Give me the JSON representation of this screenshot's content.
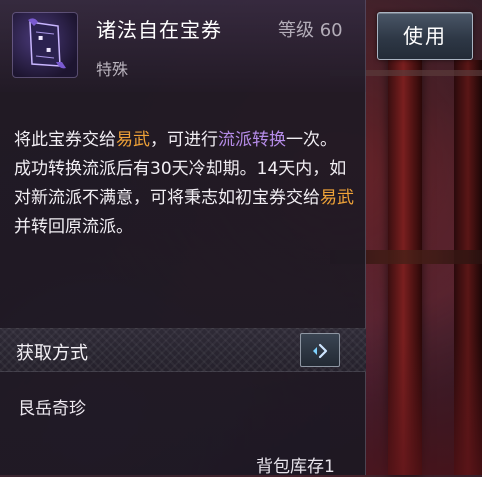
{
  "item": {
    "name": "诸法自在宝券",
    "type": "特殊",
    "level": "等级 60"
  },
  "description": {
    "line1": [
      {
        "text": "将此宝券交给",
        "style": "normal"
      },
      {
        "text": "易武",
        "style": "orange"
      },
      {
        "text": "，可进行",
        "style": "normal"
      },
      {
        "text": "流派转换",
        "style": "purple"
      },
      {
        "text": "一次。",
        "style": "normal"
      }
    ],
    "line2": [
      {
        "text": "成功转换流派后有30天冷却期。14天内，如对新流派不满意，可将秉志如初宝券交给",
        "style": "normal"
      },
      {
        "text": "易武",
        "style": "orange"
      },
      {
        "text": "并转回原流派。",
        "style": "normal"
      }
    ]
  },
  "source": {
    "title": "获取方式",
    "value": "艮岳奇珍",
    "button_icon": "chevron-right-icon"
  },
  "stock": "背包库存1",
  "use_button": "使用",
  "icon": {
    "name": "scroll-ticket-icon"
  },
  "colors": {
    "highlight_orange": "#f0a338",
    "highlight_purple": "#b58ce8",
    "panel_bg": "#201a24"
  }
}
